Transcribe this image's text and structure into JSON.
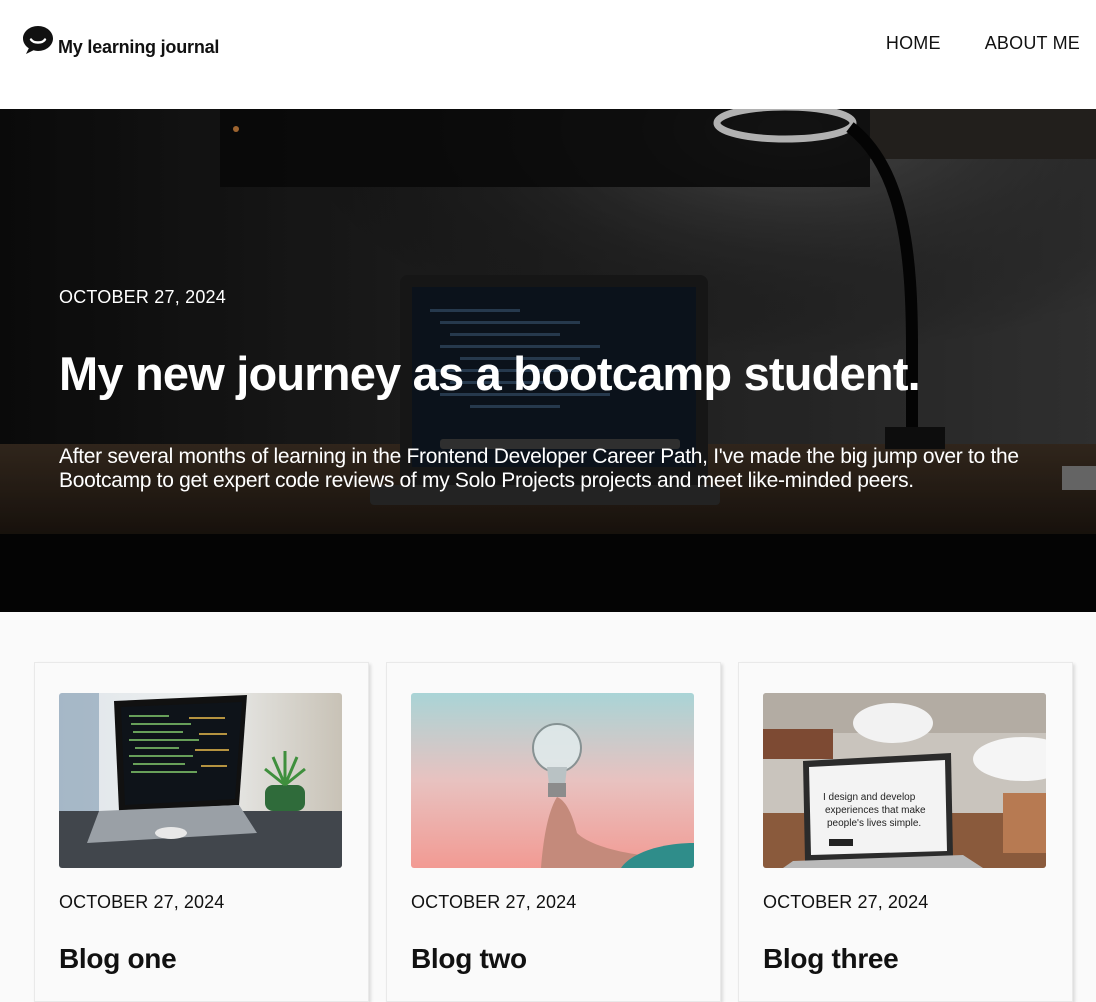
{
  "header": {
    "brand_name": "My learning journal",
    "logo_icon": "chat-bubble-icon",
    "nav": [
      {
        "label": "HOME"
      },
      {
        "label": "ABOUT ME"
      }
    ]
  },
  "hero": {
    "date": "OCTOBER 27, 2024",
    "title": "My new journey as a bootcamp student.",
    "text": "After several months of learning in the Frontend Developer Career Path, I've made the big jump over to the Bootcamp to get expert code reviews of my Solo Projects projects and meet like-minded peers."
  },
  "cards": [
    {
      "date": "OCTOBER 27, 2024",
      "title": "Blog one"
    },
    {
      "date": "OCTOBER 27, 2024",
      "title": "Blog two"
    },
    {
      "date": "OCTOBER 27, 2024",
      "title": "Blog three"
    }
  ],
  "card_three_image_text": {
    "line1": "I design and develop",
    "line2": "experiences that make",
    "line3": "people's lives simple."
  },
  "colors": {
    "header_bg": "#ffffff",
    "hero_text": "#ffffff",
    "page_bg": "#fafafa",
    "text": "#111111"
  }
}
